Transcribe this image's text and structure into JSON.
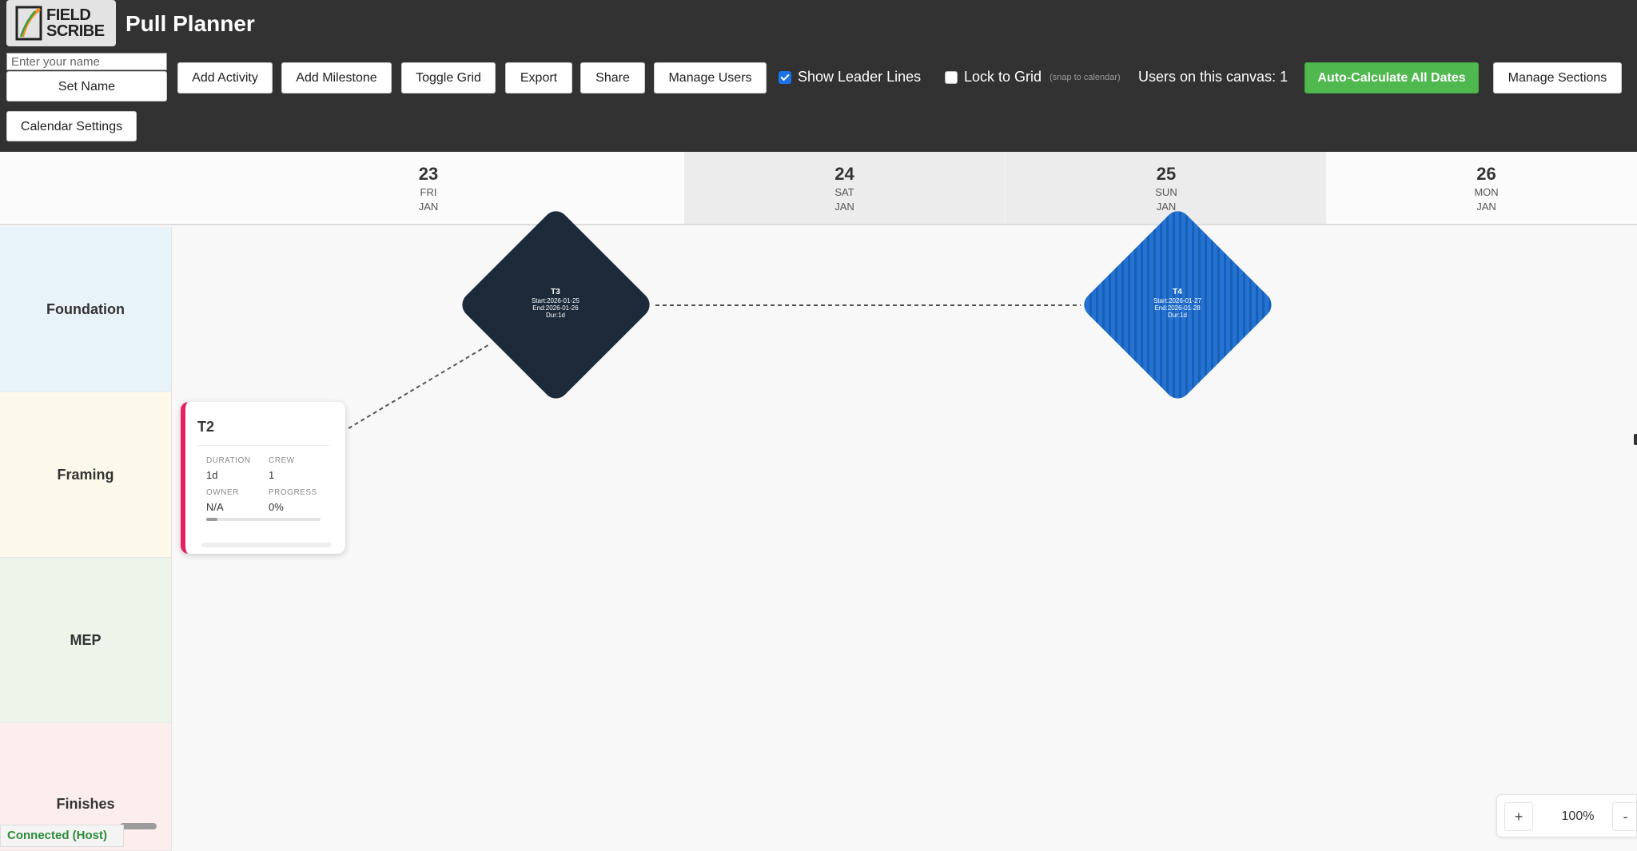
{
  "app": {
    "logo": {
      "line1": "FIELD",
      "line2": "SCRIBE"
    },
    "title": "Pull Planner"
  },
  "toolbar": {
    "name_placeholder": "Enter your name",
    "set_name": "Set Name",
    "calendar_settings": "Calendar Settings",
    "add_activity": "Add Activity",
    "add_milestone": "Add Milestone",
    "toggle_grid": "Toggle Grid",
    "export": "Export",
    "share": "Share",
    "manage_users": "Manage Users",
    "show_leader_lines": {
      "label": "Show Leader Lines",
      "checked": true
    },
    "lock_to_grid": {
      "label": "Lock to Grid",
      "note": "(snap to calendar)",
      "checked": false
    },
    "users_on_canvas": "Users on this canvas: 1",
    "auto_calculate": "Auto-Calculate All Dates",
    "manage_sections": "Manage Sections"
  },
  "calendar": {
    "days": [
      {
        "num": "23",
        "dow": "FRI",
        "mon": "JAN",
        "weekend": false
      },
      {
        "num": "24",
        "dow": "SAT",
        "mon": "JAN",
        "weekend": true
      },
      {
        "num": "25",
        "dow": "SUN",
        "mon": "JAN",
        "weekend": true
      },
      {
        "num": "26",
        "dow": "MON",
        "mon": "JAN",
        "weekend": false
      }
    ]
  },
  "sections": [
    "Foundation",
    "Framing",
    "MEP",
    "Finishes"
  ],
  "activity": {
    "id": "T2",
    "accent": "#e62060",
    "duration_label": "DURATION",
    "duration": "1d",
    "crew_label": "CREW",
    "crew": "1",
    "owner_label": "OWNER",
    "owner": "N/A",
    "progress_label": "PROGRESS",
    "progress": "0%",
    "progress_fraction": 0.1
  },
  "milestones": [
    {
      "id": "T3",
      "start": "Start:2026-01-25",
      "end": "End:2026-01-26",
      "dur": "Dur:1d",
      "color": "#1c2a3a"
    },
    {
      "id": "T4",
      "start": "Start:2026-01-27",
      "end": "End:2026-01-28",
      "dur": "Dur:1d",
      "color": "#2273d3"
    }
  ],
  "status": {
    "connection": "Connected (Host)"
  },
  "zoom": {
    "plus": "+",
    "level": "100%",
    "minus": "-"
  }
}
